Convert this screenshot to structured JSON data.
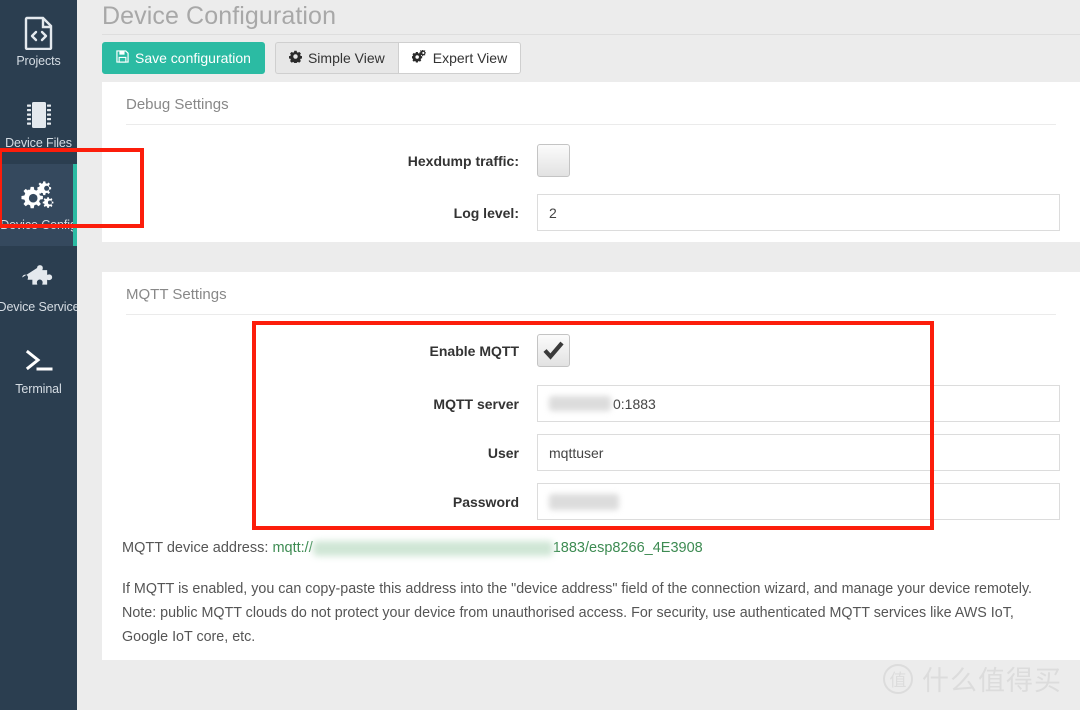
{
  "sidebar": {
    "items": [
      {
        "label": "Projects",
        "icon": "code-file-icon",
        "active": false
      },
      {
        "label": "Device Files",
        "icon": "chip-icon",
        "active": false
      },
      {
        "label": "Device Config",
        "icon": "gears-icon",
        "active": true
      },
      {
        "label": "Device Service",
        "icon": "puzzle-piece-icon",
        "active": false
      },
      {
        "label": "Terminal",
        "icon": "terminal-icon",
        "active": false
      }
    ],
    "active_accent": "#2bbba3",
    "background": "#2b3e50"
  },
  "header": {
    "title": "Device Configuration"
  },
  "toolbar": {
    "save_label": "Save configuration",
    "save_icon": "floppy-disk-icon",
    "save_color": "#2bbba3",
    "simple_view_label": "Simple View",
    "simple_view_icon": "gear-icon",
    "expert_view_label": "Expert View",
    "expert_view_icon": "gears-icon"
  },
  "debug_settings": {
    "title": "Debug Settings",
    "hexdump_label": "Hexdump traffic:",
    "hexdump_checked": false,
    "log_level_label": "Log level:",
    "log_level_value": "2",
    "log_level_placeholder": ""
  },
  "mqtt_settings": {
    "title": "MQTT Settings",
    "enable_label": "Enable MQTT",
    "enable_checked": true,
    "server_label": "MQTT server",
    "server_value_suffix": "0:1883",
    "server_value_redacted": true,
    "server_placeholder": "",
    "user_label": "User",
    "user_value": "mqttuser",
    "user_placeholder": "",
    "password_label": "Password",
    "password_value_redacted": true,
    "password_placeholder": ""
  },
  "mqtt_address": {
    "prefix": "MQTT device address: ",
    "scheme": "mqtt://",
    "suffix": "1883/esp8266_4E3908",
    "redacted": true,
    "color": "#3d8b52"
  },
  "notes": {
    "line1": "If MQTT is enabled, you can copy-paste this address into the \"device address\" field of the connection wizard, and manage your device remotely.",
    "line2": "Note: public MQTT clouds do not protect your device from unauthorised access. For security, use authenticated MQTT services like AWS IoT,",
    "line3": "Google IoT core, etc."
  },
  "annotations": {
    "highlight_color": "#fc1d0b",
    "boxes": [
      {
        "name": "sidebar-device-config-highlight"
      },
      {
        "name": "mqtt-fields-highlight"
      }
    ]
  },
  "watermark": {
    "logo_char": "值",
    "text": "什么值得买"
  }
}
